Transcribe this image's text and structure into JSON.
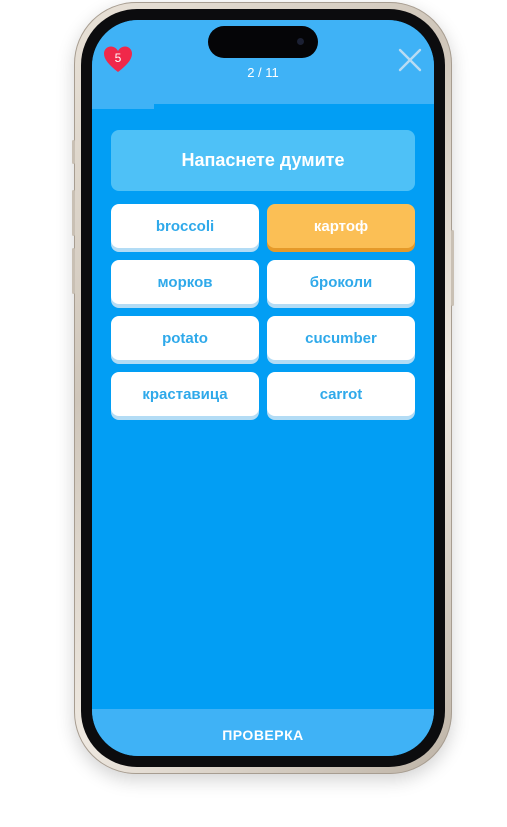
{
  "header": {
    "lives": "5",
    "progress_label": "2 / 11",
    "progress_fraction": 0.18
  },
  "prompt": {
    "text": "Напаснете думите"
  },
  "words": [
    {
      "label": "broccoli",
      "selected": false
    },
    {
      "label": "картоф",
      "selected": true
    },
    {
      "label": "морков",
      "selected": false
    },
    {
      "label": "броколи",
      "selected": false
    },
    {
      "label": "potato",
      "selected": false
    },
    {
      "label": "cucumber",
      "selected": false
    },
    {
      "label": "краставица",
      "selected": false
    },
    {
      "label": "carrot",
      "selected": false
    }
  ],
  "footer": {
    "check_label": "ПРОВЕРКА"
  },
  "colors": {
    "screen_bg": "#029ef4",
    "bar_bg": "#3fb2f6",
    "prompt_bg": "#4ec1f7",
    "tile_text": "#2fa9ea",
    "selected_tile": "#fbbf55",
    "heart": "#f0284a"
  },
  "icons": {
    "lives": "heart-icon",
    "close": "close-icon"
  }
}
